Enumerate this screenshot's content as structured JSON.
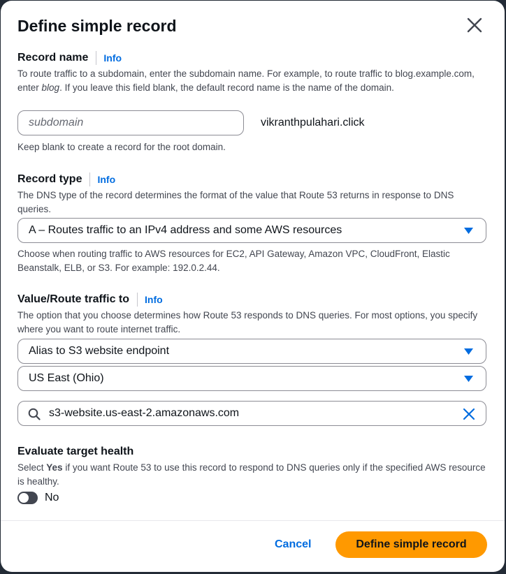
{
  "dialog": {
    "title": "Define simple record"
  },
  "record_name": {
    "label": "Record name",
    "info": "Info",
    "desc_part1": "To route traffic to a subdomain, enter the subdomain name. For example, to route traffic to blog.example.com, enter ",
    "desc_italic": "blog",
    "desc_part2": ". If you leave this field blank, the default record name is the name of the domain.",
    "placeholder": "subdomain",
    "value": "",
    "domain_suffix": "vikranthpulahari.click",
    "hint": "Keep blank to create a record for the root domain."
  },
  "record_type": {
    "label": "Record type",
    "info": "Info",
    "desc": "The DNS type of the record determines the format of the value that Route 53 returns in response to DNS queries.",
    "selected": "A – Routes traffic to an IPv4 address and some AWS resources",
    "hint": "Choose when routing traffic to AWS resources for EC2, API Gateway, Amazon VPC, CloudFront, Elastic Beanstalk, ELB, or S3. For example: 192.0.2.44."
  },
  "value_route": {
    "label": "Value/Route traffic to",
    "info": "Info",
    "desc": "The option that you choose determines how Route 53 responds to DNS queries. For most options, you specify where you want to route internet traffic.",
    "endpoint_selected": "Alias to S3 website endpoint",
    "region_selected": "US East (Ohio)",
    "search_value": "s3-website.us-east-2.amazonaws.com"
  },
  "target_health": {
    "label": "Evaluate target health",
    "desc_part1": "Select ",
    "desc_bold": "Yes",
    "desc_part2": " if you want Route 53 to use this record to respond to DNS queries only if the specified AWS resource is healthy.",
    "toggle_label": "No",
    "enabled": false
  },
  "footer": {
    "cancel_label": "Cancel",
    "submit_label": "Define simple record"
  },
  "colors": {
    "primary_button": "#ff9900",
    "link": "#006ce0"
  }
}
